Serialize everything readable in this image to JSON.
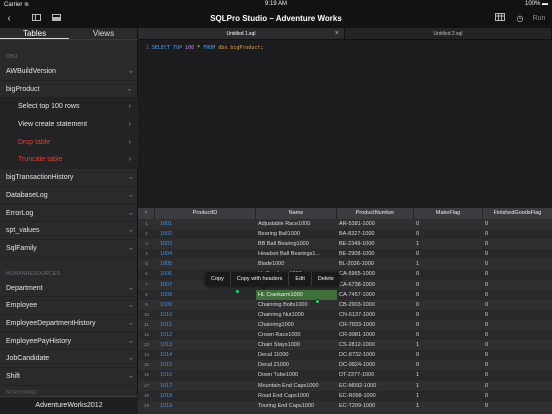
{
  "status_bar": {
    "carrier": "Carrier ≋",
    "time": "9:19 AM",
    "battery": "100% ▬"
  },
  "navbar": {
    "title": "SQLPro Studio – Adventure Works",
    "back": "‹",
    "run_label": "Run",
    "history": "◷"
  },
  "sidebar": {
    "tabs": [
      "Tables",
      "Views"
    ],
    "sections": [
      {
        "header": "DBO",
        "items": [
          {
            "label": "AWBuildVersion",
            "state": "collapsed"
          },
          {
            "label": "bigProduct",
            "state": "expanded",
            "children": [
              {
                "label": "Select top 100 rows",
                "danger": false
              },
              {
                "label": "View create statement",
                "danger": false
              },
              {
                "label": "Drop table",
                "danger": true
              },
              {
                "label": "Truncate table",
                "danger": true
              }
            ]
          },
          {
            "label": "bigTransactionHistory",
            "state": "collapsed"
          },
          {
            "label": "DatabaseLog",
            "state": "collapsed"
          },
          {
            "label": "ErrorLog",
            "state": "collapsed"
          },
          {
            "label": "spt_values",
            "state": "collapsed"
          },
          {
            "label": "SqlFamily",
            "state": "collapsed"
          }
        ]
      },
      {
        "header": "HUMANRESOURCES",
        "items": [
          {
            "label": "Department",
            "state": "collapsed"
          },
          {
            "label": "Employee",
            "state": "collapsed"
          },
          {
            "label": "EmployeeDepartmentHistory",
            "state": "collapsed"
          },
          {
            "label": "EmployeePayHistory",
            "state": "collapsed"
          },
          {
            "label": "JobCandidate",
            "state": "collapsed"
          },
          {
            "label": "Shift",
            "state": "collapsed"
          }
        ]
      }
    ],
    "next_section_header": "NORTHWIND",
    "footer": "AdventureWorks2012"
  },
  "editor_tabs": [
    {
      "label": "Untitled 1.sql",
      "active": true
    },
    {
      "label": "Untitled 2.sql",
      "active": false
    }
  ],
  "close_glyph": "×",
  "editor": {
    "line_number": "1",
    "tokens": {
      "select": "SELECT",
      "top": "TOP",
      "n": "100",
      "star": "*",
      "from": "FROM",
      "table": "dbo.bigProduct",
      "semi": ";"
    }
  },
  "results": {
    "corner": "#",
    "columns": [
      "ProductID",
      "Name",
      "ProductNumber",
      "MakeFlag",
      "FinishedGoodsFlag"
    ],
    "rows": [
      [
        "1001",
        "Adjustable Race1000",
        "AR-5381-1000",
        "0",
        "0"
      ],
      [
        "1002",
        "Bearing Ball1000",
        "BA-8327-1000",
        "0",
        "0"
      ],
      [
        "1003",
        "BB Ball Bearing1000",
        "BE-2349-1000",
        "1",
        "0"
      ],
      [
        "1004",
        "Headset Ball Bearings1...",
        "BE-2908-1000",
        "0",
        "0"
      ],
      [
        "1005",
        "Blade1000",
        "BL-2036-1000",
        "1",
        "0"
      ],
      [
        "1006",
        "LL Crankarm1000",
        "CA-5965-1000",
        "0",
        "0"
      ],
      [
        "1007",
        "ML Crankarm1000",
        "CA-6738-1000",
        "0",
        "0"
      ],
      [
        "1008",
        "HL Crankarm1000",
        "CA-7457-1000",
        "0",
        "0"
      ],
      [
        "1009",
        "Chainring Bolts1000",
        "CB-2903-1000",
        "0",
        "0"
      ],
      [
        "1010",
        "Chainring Nut1000",
        "CN-6137-1000",
        "0",
        "0"
      ],
      [
        "1011",
        "Chainring1000",
        "CR-7833-1000",
        "0",
        "0"
      ],
      [
        "1012",
        "Crown Race1000",
        "CR-9981-1000",
        "0",
        "0"
      ],
      [
        "1013",
        "Chain Stays1000",
        "CS-2812-1000",
        "1",
        "0"
      ],
      [
        "1014",
        "Decal 11000",
        "DC-8732-1000",
        "0",
        "0"
      ],
      [
        "1015",
        "Decal 21000",
        "DC-9824-1000",
        "0",
        "0"
      ],
      [
        "1016",
        "Down Tube1000",
        "DT-2377-1000",
        "1",
        "0"
      ],
      [
        "1017",
        "Mountain End Caps1000",
        "EC-M092-1000",
        "1",
        "0"
      ],
      [
        "1018",
        "Road End Caps1000",
        "EC-R098-1000",
        "1",
        "0"
      ],
      [
        "1019",
        "Touring End Caps1000",
        "EC-T209-1000",
        "1",
        "0"
      ]
    ],
    "selected_row": 7
  },
  "context_menu": [
    "Copy",
    "Copy with headers",
    "Edit",
    "Delete"
  ],
  "colors": {
    "accent": "#3d8ee0",
    "danger": "#d8403a",
    "selection": "#3f6f3a",
    "handle": "#2ecc71"
  }
}
